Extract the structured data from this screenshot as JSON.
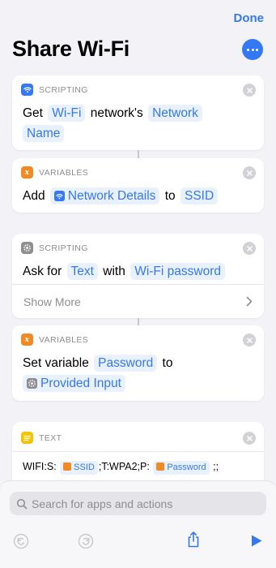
{
  "header": {
    "done_label": "Done",
    "title": "Share Wi-Fi"
  },
  "actions": [
    {
      "category": "SCRIPTING",
      "icon": "wifi-icon",
      "color": "#3478f6",
      "parts": [
        "Get",
        "Wi-Fi",
        "network's",
        "Network",
        "Name"
      ]
    },
    {
      "category": "VARIABLES",
      "icon": "variable-icon",
      "color": "#f08a24",
      "parts": [
        "Add",
        "Network Details",
        "to",
        "SSID"
      ]
    },
    {
      "category": "SCRIPTING",
      "icon": "gear-icon",
      "color": "#8e8e93",
      "parts": [
        "Ask for",
        "Text",
        "with",
        "Wi-Fi password"
      ],
      "show_more": "Show More"
    },
    {
      "category": "VARIABLES",
      "icon": "variable-icon",
      "color": "#f08a24",
      "parts": [
        "Set variable",
        "Password",
        "to",
        "Provided Input"
      ]
    },
    {
      "category": "TEXT",
      "icon": "text-icon",
      "color": "#f5c400",
      "parts": [
        "WIFI:S:",
        "SSID",
        ";T:WPA2;P:",
        "Password",
        ";;"
      ]
    }
  ],
  "bottom": {
    "search_placeholder": "Search for apps and actions"
  },
  "accent": "#3478f6"
}
